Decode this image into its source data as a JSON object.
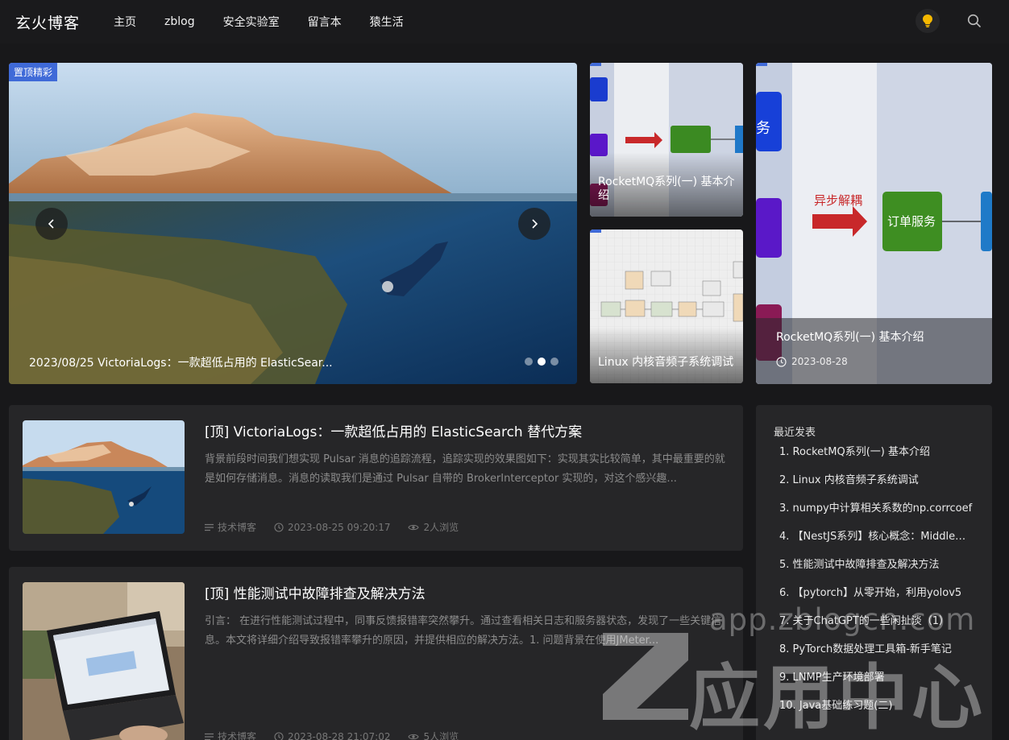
{
  "header": {
    "logo": "玄火博客",
    "nav": [
      "主页",
      "zblog",
      "安全实验室",
      "留言本",
      "猿生活"
    ]
  },
  "banner": {
    "pin_tag": "置顶精彩",
    "caption": "2023/08/25 VictoriaLogs：一款超低占用的 ElasticSear...",
    "dots": 3,
    "active_dot": 2,
    "side_top": "RocketMQ系列(一) 基本介绍",
    "side_bottom": "Linux 内核音频子系统调试",
    "feature_title": "RocketMQ系列(一) 基本介绍",
    "feature_date": "2023-08-28",
    "diagram_left": "异步解耦",
    "diagram_right": "订单服务",
    "diagram_edge": "务"
  },
  "posts": [
    {
      "title": "[顶] VictoriaLogs：一款超低占用的 ElasticSearch 替代方案",
      "excerpt": "背景前段时间我们想实现 Pulsar 消息的追踪流程，追踪实现的效果图如下：实现其实比较简单，其中最重要的就是如何存储消息。消息的读取我们是通过 Pulsar 自带的 BrokerInterceptor 实现的，对这个感兴趣...",
      "category": "技术博客",
      "time": "2023-08-25 09:20:17",
      "views": "2人浏览"
    },
    {
      "title": "[顶] 性能测试中故障排查及解决方法",
      "excerpt": "引言： 在进行性能测试过程中，同事反馈报错率突然攀升。通过查看相关日志和服务器状态，发现了一些关键信息。本文将详细介绍导致报错率攀升的原因，并提供相应的解决方法。1. 问题背景在使用JMeter...",
      "category": "技术博客",
      "time": "2023-08-28 21:07:02",
      "views": "5人浏览"
    }
  ],
  "sidebar": {
    "title": "最近发表",
    "items": [
      "RocketMQ系列(一) 基本介绍",
      "Linux 内核音频子系统调试",
      "numpy中计算相关系数的np.corrcoef",
      "【NestJS系列】核心概念：Middleware中间件",
      "性能测试中故障排查及解决方法",
      "【pytorch】从零开始，利用yolov5",
      "关于ChatGPT的一些闲扯淡（1）",
      "PyTorch数据处理工具箱-新手笔记",
      "LNMP生产环境部署",
      "Java基础练习题(二)"
    ]
  },
  "watermark": {
    "domain": "app.zblogcn.com",
    "label": "应用中心"
  },
  "colors": {
    "accent": "#3f6ad8",
    "bulb": "#f5b800",
    "bg": "#18181a",
    "card": "#262628"
  }
}
